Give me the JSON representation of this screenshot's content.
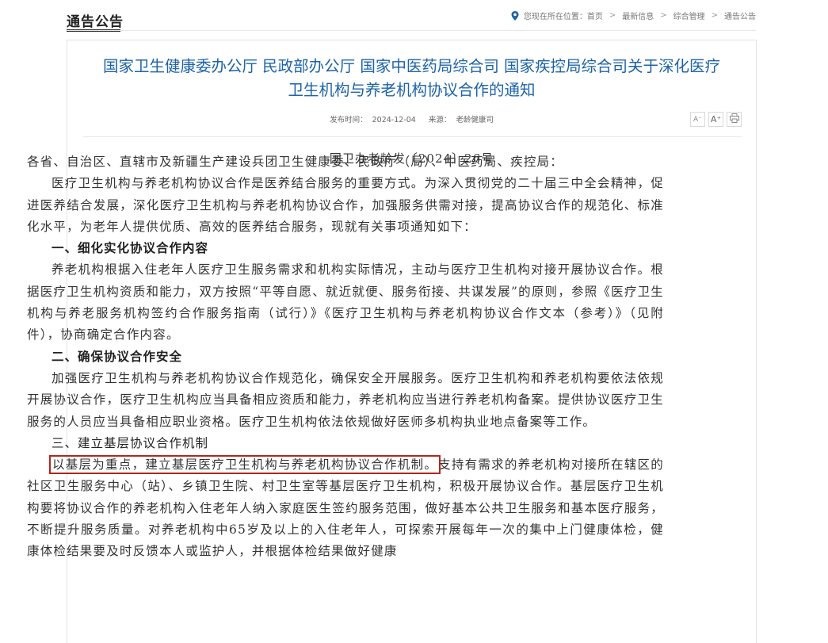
{
  "header": {
    "section_title": "通告公告",
    "breadcrumb_prefix": "您现在所在位置：",
    "crumbs": [
      "首页",
      "最新信息",
      "综合管理",
      "通告公告"
    ],
    "separator": ">"
  },
  "article": {
    "title_line1": "国家卫生健康委办公厅 民政部办公厅 国家中医药局综合司 国家疾控局综合司关于深化医疗",
    "title_line2": "卫生机构与养老机构协议合作的通知",
    "publish_label": "发布时间：",
    "publish_date": "2024-12-04",
    "source_label": "来源：",
    "source": "老龄健康司",
    "tools": {
      "font_smaller": "A⁻",
      "font_larger": "A⁺",
      "print_icon": "printer-icon"
    },
    "doc_number": "国卫办老龄发〔2024〕26号",
    "salutation": "各省、自治区、直辖市及新疆生产建设兵团卫生健康委、民政厅（局）、中医药局、疾控局：",
    "intro": "医疗卫生机构与养老机构协议合作是医养结合服务的重要方式。为深入贯彻党的二十届三中全会精神，促进医养结合发展，深化医疗卫生机构与养老机构协议合作，加强服务供需对接，提高协议合作的规范化、标准化水平，为老年人提供优质、高效的医养结合服务，现就有关事项通知如下：",
    "sections": [
      {
        "heading": "一、细化实化协议合作内容",
        "text": "养老机构根据入住老年人医疗卫生服务需求和机构实际情况，主动与医疗卫生机构对接开展协议合作。根据医疗卫生机构资质和能力，双方按照“平等自愿、就近就便、服务衔接、共谋发展”的原则，参照《医疗卫生机构与养老服务机构签约合作服务指南（试行）》《医疗卫生机构与养老机构协议合作文本（参考）》（见附件），协商确定合作内容。"
      },
      {
        "heading": "二、确保协议合作安全",
        "text": "加强医疗卫生机构与养老机构协议合作规范化，确保安全开展服务。医疗卫生机构和养老机构要依法依规开展协议合作，医疗卫生机构应当具备相应资质和能力，养老机构应当进行养老机构备案。提供协议医疗卫生服务的人员应当具备相应职业资格。医疗卫生机构依法依规做好医师多机构执业地点备案等工作。"
      },
      {
        "heading": "三、建立基层协议合作机制",
        "highlight": "以基层为重点，建立基层医疗卫生机构与养老机构协议合作机制。",
        "text": "支持有需求的养老机构对接所在辖区的社区卫生服务中心（站）、乡镇卫生院、村卫生室等基层医疗卫生机构，积极开展协议合作。基层医疗卫生机构要将协议合作的养老机构入住老年人纳入家庭医生签约服务范围，做好基本公共卫生服务和基本医疗服务，不断提升服务质量。对养老机构中65岁及以上的入住老年人，可探索开展每年一次的集中上门健康体检，健康体检结果要及时反馈本人或监护人，并根据体检结果做好健康"
      }
    ]
  }
}
